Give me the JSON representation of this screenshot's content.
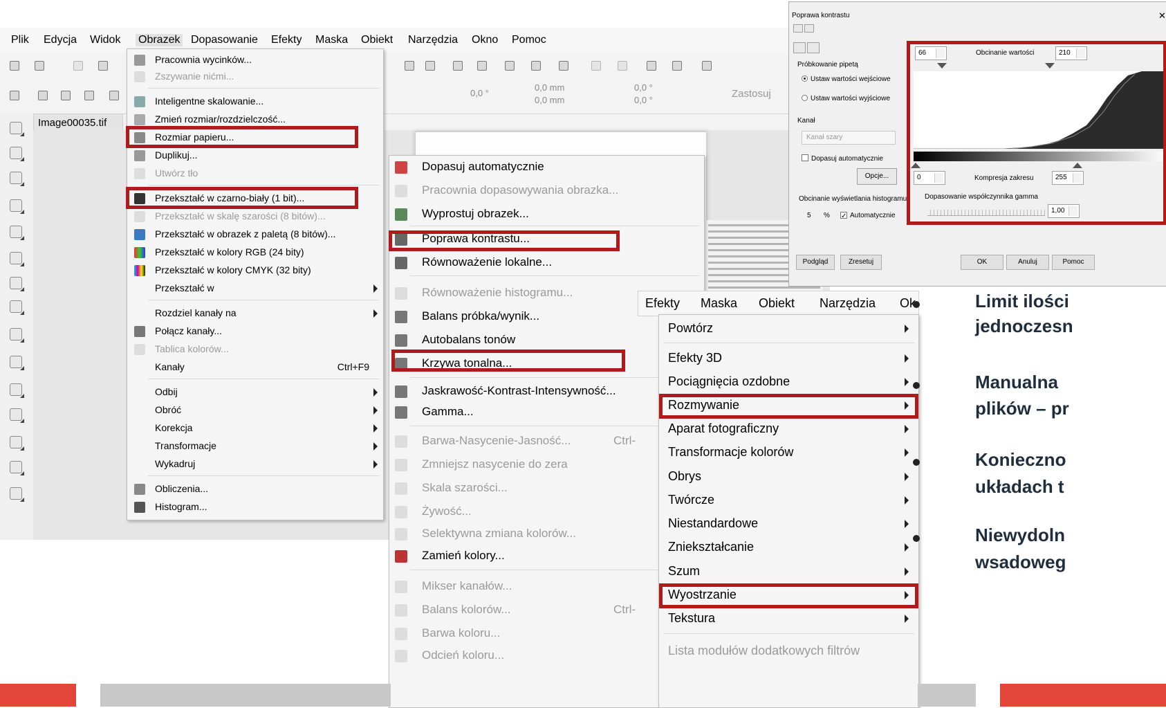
{
  "app": {
    "menubar": [
      "Plik",
      "Edycja",
      "Widok",
      "Obrazek",
      "Dopasowanie",
      "Efekty",
      "Maska",
      "Obiekt",
      "Narzędzia",
      "Okno",
      "Pomoc"
    ],
    "toolbar": {
      "angle1": "0,0 °",
      "size_x": "0,0 mm",
      "size_y": "0,0 mm",
      "angle_x": "0,0 °",
      "angle_y": "0,0 °",
      "apply_label": "Zastosuj"
    },
    "doc_tab": "Image00035.tif"
  },
  "obrazek_menu": {
    "items": [
      {
        "label": "Pracownia wycinków...",
        "disabled": false,
        "submenu": false,
        "icon": "scissors-icon"
      },
      {
        "label": "Zszywanie nićmi...",
        "disabled": true,
        "submenu": false,
        "icon": "stitch-icon"
      },
      {
        "label": "Inteligentne skalowanie...",
        "disabled": false,
        "submenu": false,
        "icon": "smart-scale-icon"
      },
      {
        "label": "Zmień rozmiar/rozdzielczość...",
        "disabled": false,
        "submenu": false,
        "icon": "resize-icon"
      },
      {
        "label": "Rozmiar papieru...",
        "disabled": false,
        "submenu": false,
        "icon": "paper-size-icon"
      },
      {
        "label": "Duplikuj...",
        "disabled": false,
        "submenu": false,
        "icon": "duplicate-icon"
      },
      {
        "label": "Utwórz tło",
        "disabled": true,
        "submenu": false,
        "icon": "background-icon"
      },
      {
        "label": "Przekształć w czarno-biały (1 bit)...",
        "disabled": false,
        "submenu": false,
        "icon": "bw-icon"
      },
      {
        "label": "Przekształć w skalę szarości (8 bitów)...",
        "disabled": true,
        "submenu": false,
        "icon": "grayscale-icon"
      },
      {
        "label": "Przekształć w obrazek z paletą (8 bitów)...",
        "disabled": false,
        "submenu": false,
        "icon": "palette-icon"
      },
      {
        "label": "Przekształć w kolory RGB (24 bity)",
        "disabled": false,
        "submenu": false,
        "icon": "rgb-icon"
      },
      {
        "label": "Przekształć w kolory CMYK (32 bity)",
        "disabled": false,
        "submenu": false,
        "icon": "cmyk-icon"
      },
      {
        "label": "Przekształć w",
        "disabled": false,
        "submenu": true,
        "icon": ""
      },
      {
        "label": "Rozdziel kanały na",
        "disabled": false,
        "submenu": true,
        "icon": ""
      },
      {
        "label": "Połącz kanały...",
        "disabled": false,
        "submenu": false,
        "icon": "combine-channels-icon"
      },
      {
        "label": "Tablica kolorów...",
        "disabled": true,
        "submenu": false,
        "icon": "color-table-icon"
      },
      {
        "label": "Kanały",
        "disabled": false,
        "submenu": false,
        "icon": "",
        "shortcut": "Ctrl+F9"
      },
      {
        "label": "Odbij",
        "disabled": false,
        "submenu": true,
        "icon": ""
      },
      {
        "label": "Obróć",
        "disabled": false,
        "submenu": true,
        "icon": ""
      },
      {
        "label": "Korekcja",
        "disabled": false,
        "submenu": true,
        "icon": ""
      },
      {
        "label": "Transformacje",
        "disabled": false,
        "submenu": true,
        "icon": ""
      },
      {
        "label": "Wykadruj",
        "disabled": false,
        "submenu": true,
        "icon": ""
      },
      {
        "label": "Obliczenia...",
        "disabled": false,
        "submenu": false,
        "icon": "calculator-icon"
      },
      {
        "label": "Histogram...",
        "disabled": false,
        "submenu": false,
        "icon": "histogram-icon"
      }
    ]
  },
  "dopasowanie_menu": {
    "items": [
      {
        "label": "Dopasuj automatycznie",
        "disabled": false
      },
      {
        "label": "Pracownia dopasowywania obrazka...",
        "disabled": true
      },
      {
        "label": "Wyprostuj obrazek...",
        "disabled": false
      },
      {
        "label": "Poprawa kontrastu...",
        "disabled": false
      },
      {
        "label": "Równoważenie lokalne...",
        "disabled": false
      },
      {
        "label": "Równoważenie histogramu...",
        "disabled": true
      },
      {
        "label": "Balans próbka/wynik...",
        "disabled": false
      },
      {
        "label": "Autobalans tonów",
        "disabled": false
      },
      {
        "label": "Krzywa tonalna...",
        "disabled": false
      },
      {
        "label": "Jaskrawość-Kontrast-Intensywność...",
        "disabled": false
      },
      {
        "label": "Gamma...",
        "disabled": false
      },
      {
        "label": "Barwa-Nasycenie-Jasność...",
        "disabled": true,
        "shortcut": "Ctrl-"
      },
      {
        "label": "Zmniejsz nasycenie do zera",
        "disabled": true
      },
      {
        "label": "Skala szarości...",
        "disabled": true
      },
      {
        "label": "Żywość...",
        "disabled": true
      },
      {
        "label": "Selektywna zmiana kolorów...",
        "disabled": true
      },
      {
        "label": "Zamień kolory...",
        "disabled": false
      },
      {
        "label": "Mikser kanałów...",
        "disabled": true
      },
      {
        "label": "Balans kolorów...",
        "disabled": true,
        "shortcut": "Ctrl-"
      },
      {
        "label": "Barwa koloru...",
        "disabled": true
      },
      {
        "label": "Odcień koloru...",
        "disabled": true
      }
    ]
  },
  "efekty_bar": [
    "Efekty",
    "Maska",
    "Obiekt",
    "Narzędzia",
    "Ok"
  ],
  "efekty_menu": {
    "items": [
      {
        "label": "Powtórz",
        "submenu": true,
        "disabled": false
      },
      {
        "label": "Efekty 3D",
        "submenu": true,
        "disabled": false
      },
      {
        "label": "Pociągnięcia ozdobne",
        "submenu": true,
        "disabled": false
      },
      {
        "label": "Rozmywanie",
        "submenu": true,
        "disabled": false
      },
      {
        "label": "Aparat fotograficzny",
        "submenu": true,
        "disabled": false
      },
      {
        "label": "Transformacje kolorów",
        "submenu": true,
        "disabled": false
      },
      {
        "label": "Obrys",
        "submenu": true,
        "disabled": false
      },
      {
        "label": "Twórcze",
        "submenu": true,
        "disabled": false
      },
      {
        "label": "Niestandardowe",
        "submenu": true,
        "disabled": false
      },
      {
        "label": "Zniekształcanie",
        "submenu": true,
        "disabled": false
      },
      {
        "label": "Szum",
        "submenu": true,
        "disabled": false
      },
      {
        "label": "Wyostrzanie",
        "submenu": true,
        "disabled": false
      },
      {
        "label": "Tekstura",
        "submenu": true,
        "disabled": false
      },
      {
        "label": "Lista modułów dodatkowych filtrów",
        "submenu": false,
        "disabled": true
      }
    ]
  },
  "dialog": {
    "title": "Poprawa kontrastu",
    "sampling_label": "Próbkowanie pipetą",
    "radio_input": "Ustaw wartości wejściowe",
    "radio_output": "Ustaw wartości wyjściowe",
    "channel_label": "Kanał",
    "channel_value": "Kanał szary",
    "auto_adjust": "Dopasuj automatycznie",
    "options_button": "Opcje...",
    "hist_clip_label": "Obcinanie wyświetlania histogramu",
    "hist_clip_value": "5",
    "percent": "%",
    "automatic": "Automatycznie",
    "clip_low": "66",
    "clip_label": "Obcinanie wartości",
    "clip_high": "210",
    "out_low": "0",
    "compress_label": "Kompresja zakresu",
    "out_high": "255",
    "gamma_label": "Dopasowanie współczynnika gamma",
    "gamma_value": "1,00",
    "preview": "Podgląd",
    "reset": "Zresetuj",
    "ok": "OK",
    "cancel": "Anuluj",
    "help": "Pomoc"
  },
  "bullets": [
    "Limit ilości",
    "jednoczesn",
    "Manualna",
    "plików – pr",
    "Konieczno",
    "układach t",
    "Niewydoln",
    "wsadoweg"
  ],
  "colors": {
    "highlight": "#b01a1a",
    "accent_bar": "#e2453a",
    "footer_gray": "#c8c8c8"
  }
}
